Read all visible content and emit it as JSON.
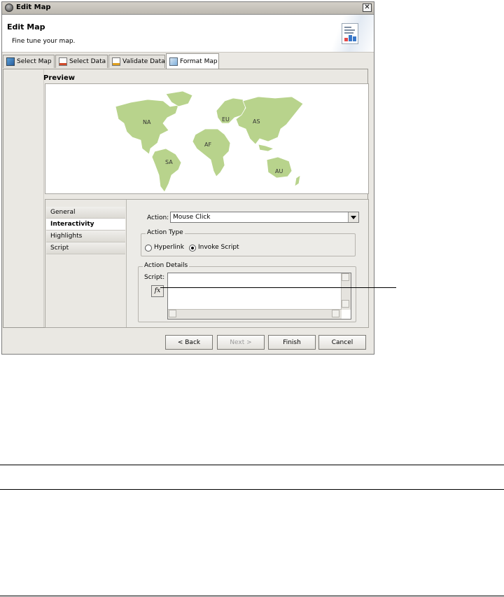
{
  "window": {
    "title": "Edit Map",
    "close_glyph": "✕"
  },
  "header": {
    "title": "Edit Map",
    "subtitle": "Fine tune your map.",
    "graphic_icon": "map-report-icon"
  },
  "tabs": [
    {
      "label": "Select Map",
      "icon": "select-map-icon"
    },
    {
      "label": "Select Data",
      "icon": "select-data-icon"
    },
    {
      "label": "Validate Data",
      "icon": "validate-data-icon"
    },
    {
      "label": "Format Map",
      "icon": "format-map-icon",
      "active": true
    }
  ],
  "preview": {
    "label": "Preview",
    "land_color": "#b8d38c",
    "continents": [
      "NA",
      "SA",
      "EU",
      "AF",
      "AS",
      "AU"
    ]
  },
  "nav": {
    "items": [
      "General",
      "Interactivity",
      "Highlights",
      "Script"
    ],
    "selected": "Interactivity"
  },
  "interactivity": {
    "action_label": "Action:",
    "action_value": "Mouse Click",
    "action_type_group": "Action Type",
    "radio_hyperlink": "Hyperlink",
    "radio_invoke_script": "Invoke Script",
    "selected_action_type": "Invoke Script",
    "action_details_group": "Action Details",
    "script_label": "Script:",
    "script_value": "",
    "fx_button": "fx"
  },
  "buttons": {
    "back": "< Back",
    "next": "Next >",
    "finish": "Finish",
    "cancel": "Cancel"
  }
}
